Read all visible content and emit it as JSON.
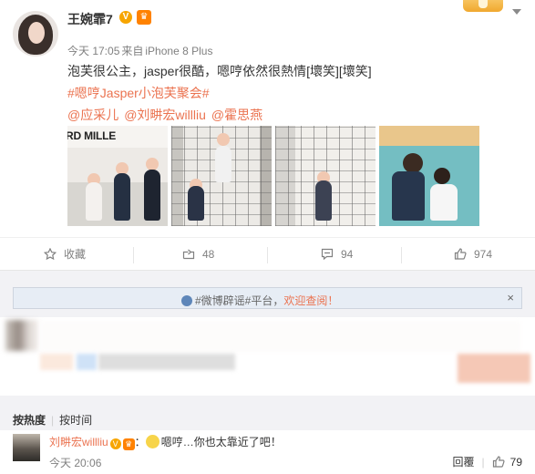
{
  "post": {
    "username": "王婉霏7",
    "verified_icon": "verified-v-badge",
    "vip_icon": "vip-crown-icon",
    "time": "今天 17:05",
    "source_prefix": "来自",
    "source": "iPhone 8 Plus",
    "text": "泡芙很公主，jasper很酷，嗯哼依然很熱情[壞笑][壞笑]",
    "hashtag": "#嗯哼Jasper小泡芙聚会#",
    "mentions": [
      "@应采儿",
      "@刘畊宏willliu",
      "@霍思燕"
    ],
    "photo_brand_text": "RD MILLE",
    "photo_count": 4
  },
  "actions": {
    "save": "收藏",
    "forward_count": "48",
    "comment_count": "94",
    "like_count": "974"
  },
  "notice": {
    "hashtag": "#微博辟谣#平台，",
    "link": "欢迎查阅！",
    "close": "×"
  },
  "sort": {
    "by_hot": "按热度",
    "by_time": "按时间"
  },
  "comment": {
    "user": "刘畊宏willliu",
    "separator": "：",
    "text": "嗯哼…你也太靠近了吧！",
    "time": "今天 20:06",
    "reply": "回覆",
    "like_count": "79"
  },
  "colors": {
    "accent": "#eb7350",
    "notice_bg": "#e7edf5",
    "comment_bg": "#f2f2f5"
  }
}
